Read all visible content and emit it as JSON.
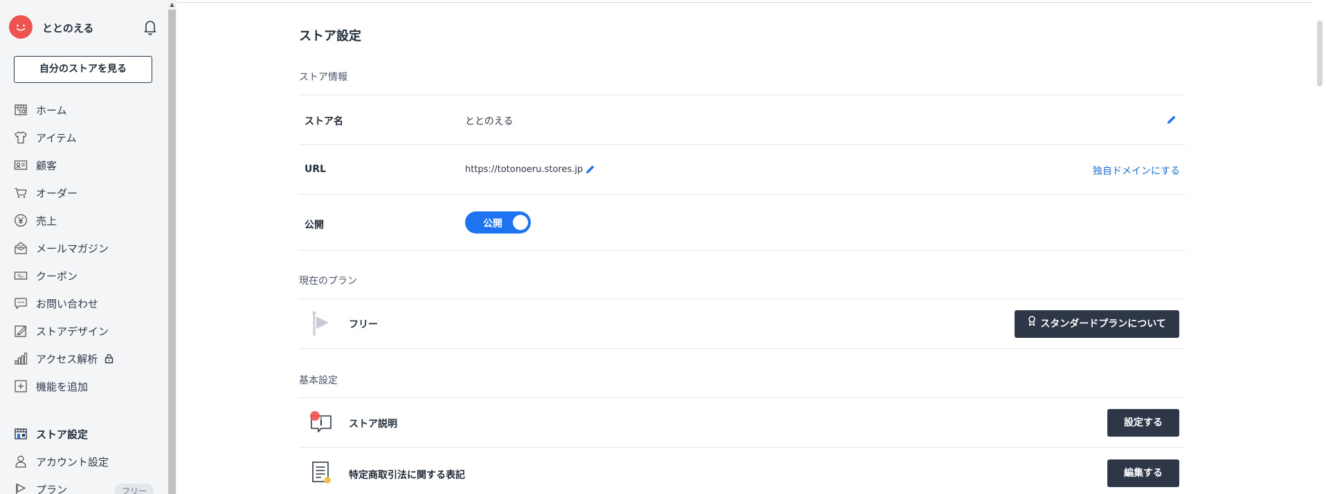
{
  "sidebar": {
    "store_name": "ととのえる",
    "view_store_button": "自分のストアを見る",
    "items": [
      {
        "label": "ホーム",
        "icon": "shop-icon"
      },
      {
        "label": "アイテム",
        "icon": "shirt-icon"
      },
      {
        "label": "顧客",
        "icon": "customer-card-icon"
      },
      {
        "label": "オーダー",
        "icon": "cart-icon"
      },
      {
        "label": "売上",
        "icon": "yen-icon"
      },
      {
        "label": "メールマガジン",
        "icon": "mail-icon"
      },
      {
        "label": "クーポン",
        "icon": "coupon-icon"
      },
      {
        "label": "お問い合わせ",
        "icon": "chat-icon"
      },
      {
        "label": "ストアデザイン",
        "icon": "design-icon"
      },
      {
        "label": "アクセス解析",
        "icon": "analytics-icon"
      },
      {
        "label": "機能を追加",
        "icon": "plus-box-icon"
      }
    ],
    "bottom_items": [
      {
        "label": "ストア設定",
        "icon": "store-settings-icon"
      },
      {
        "label": "アカウント設定",
        "icon": "user-icon"
      },
      {
        "label": "プラン",
        "icon": "flag-icon",
        "badge": "フリー"
      }
    ]
  },
  "main": {
    "title": "ストア設定",
    "store_info": {
      "section": "ストア情報",
      "name_label": "ストア名",
      "name_value": "ととのえる",
      "url_label": "URL",
      "url_value": "https://totonoeru.stores.jp",
      "domain_link": "独自ドメインにする",
      "publish_label": "公開",
      "publish_toggle": "公開"
    },
    "plan": {
      "section": "現在のプラン",
      "current": "フリー",
      "standard_button": "スタンダードプランについて"
    },
    "basic": {
      "section": "基本設定",
      "description_label": "ストア説明",
      "description_button": "設定する",
      "law_label": "特定商取引法に関する表記",
      "law_button": "編集する"
    }
  },
  "colors": {
    "accent_blue": "#1e74f0",
    "dark_button": "#2d3748",
    "avatar_red": "#ef5350"
  }
}
